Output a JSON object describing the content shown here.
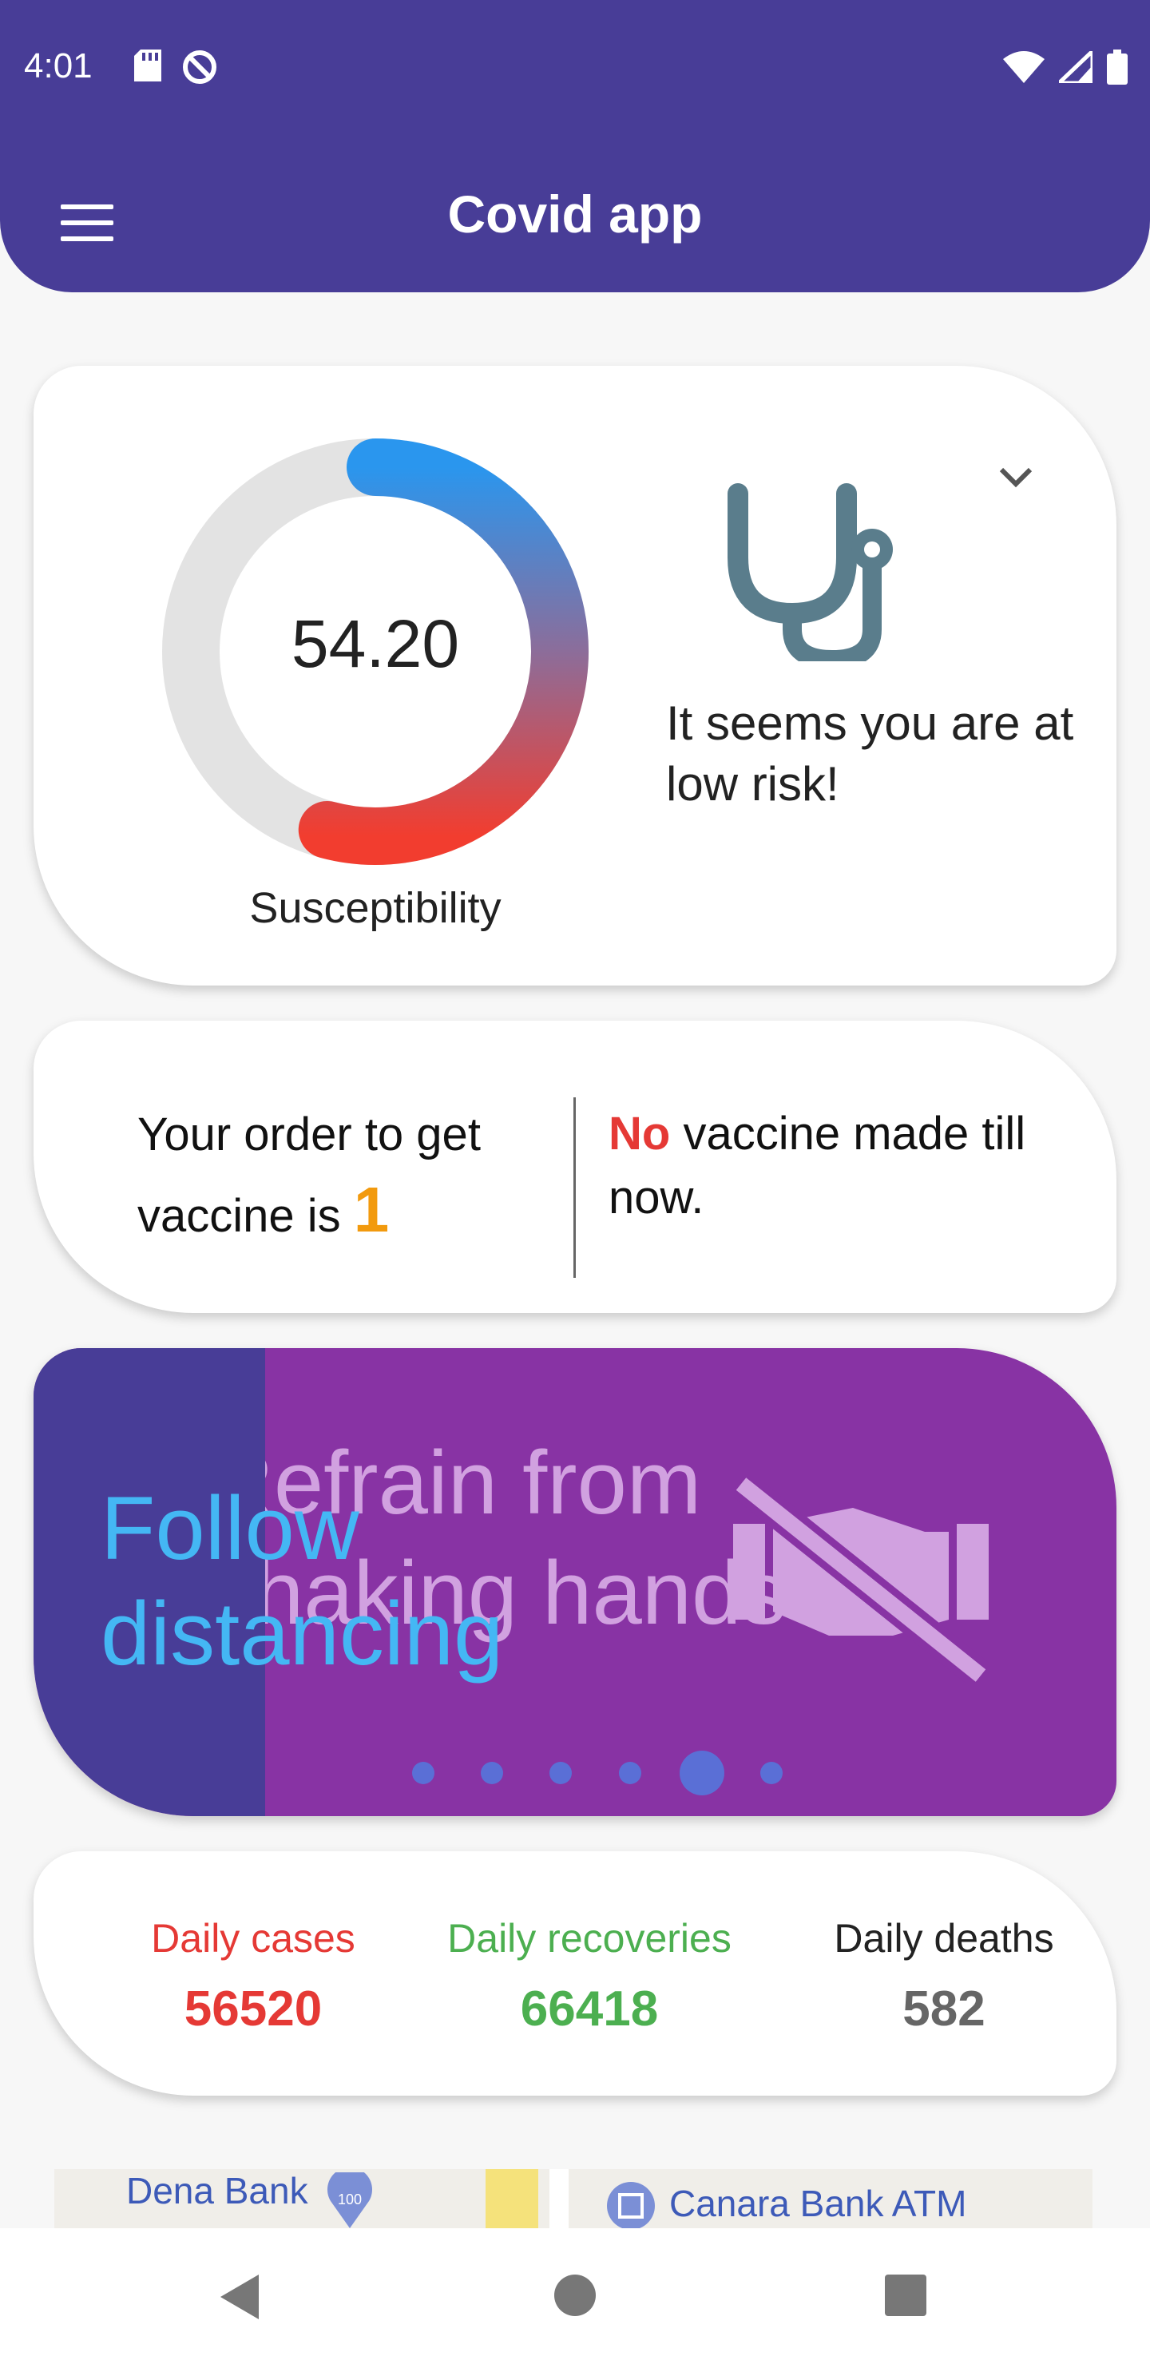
{
  "status_bar": {
    "time": "4:01"
  },
  "app_bar": {
    "title": "Covid app"
  },
  "susceptibility": {
    "value": "54.20",
    "value_fraction": 0.542,
    "caption": "Susceptibility",
    "risk_message": "It seems you are at low risk!"
  },
  "vaccine": {
    "order_prefix": "Your order to get vaccine is",
    "order_number": "1",
    "no_word": "No",
    "status_rest": "vaccine made till now."
  },
  "carousel": {
    "current_text": "Refrain from shaking hands",
    "prev_text": "Follow distancing",
    "dot_count": 6,
    "active_index": 4
  },
  "daily": {
    "cases_label": "Daily cases",
    "cases_value": "56520",
    "recoveries_label": "Daily recoveries",
    "recoveries_value": "66418",
    "deaths_label": "Daily deaths",
    "deaths_value": "582"
  },
  "map": {
    "label_1": "Dena Bank",
    "label_2": "Canara Bank ATM"
  },
  "colors": {
    "primary": "#483d97",
    "cases": "#e53935",
    "recoveries": "#4caf50",
    "deaths": "#666666",
    "carousel_bg": "#8833a4"
  }
}
